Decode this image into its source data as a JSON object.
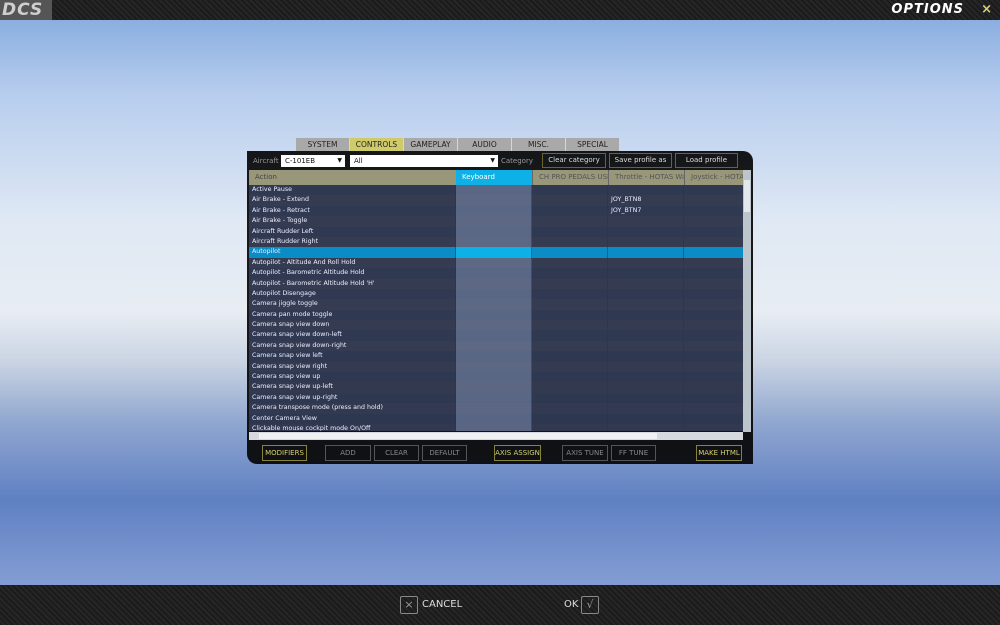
{
  "header": {
    "logo": "DCS",
    "title": "OPTIONS",
    "close": "×"
  },
  "tabs": [
    {
      "label": "SYSTEM"
    },
    {
      "label": "CONTROLS",
      "active": true
    },
    {
      "label": "GAMEPLAY"
    },
    {
      "label": "AUDIO"
    },
    {
      "label": "MISC."
    },
    {
      "label": "SPECIAL"
    }
  ],
  "toolbar": {
    "aircraft_label": "Aircraft",
    "aircraft_value": "C-101EB",
    "category_value": "All",
    "category_label": "Category",
    "clear_category": "Clear category",
    "save_profile": "Save profile as",
    "load_profile": "Load profile"
  },
  "columns": [
    "Action",
    "Keyboard",
    "CH PRO PEDALS USB",
    "Throttle - HOTAS Warthog",
    "Joystick - HOTAS Warthog"
  ],
  "rows": [
    [
      "Active Pause",
      "",
      "",
      "",
      ""
    ],
    [
      "Air Brake - Extend",
      "",
      "",
      "JOY_BTN8",
      ""
    ],
    [
      "Air Brake - Retract",
      "",
      "",
      "JOY_BTN7",
      ""
    ],
    [
      "Air Brake - Toggle",
      "",
      "",
      "",
      ""
    ],
    [
      "Aircraft Rudder Left",
      "",
      "",
      "",
      ""
    ],
    [
      "Aircraft Rudder Right",
      "",
      "",
      "",
      ""
    ],
    [
      "Autopilot",
      "",
      "",
      "",
      ""
    ],
    [
      "Autopilot - Altitude And Roll Hold",
      "",
      "",
      "",
      ""
    ],
    [
      "Autopilot - Barometric Altitude Hold",
      "",
      "",
      "",
      ""
    ],
    [
      "Autopilot - Barometric Altitude Hold 'H'",
      "",
      "",
      "",
      ""
    ],
    [
      "Autopilot Disengage",
      "",
      "",
      "",
      ""
    ],
    [
      "Camera jiggle toggle",
      "",
      "",
      "",
      ""
    ],
    [
      "Camera pan mode toggle",
      "",
      "",
      "",
      ""
    ],
    [
      "Camera snap view down",
      "",
      "",
      "",
      ""
    ],
    [
      "Camera snap view down-left",
      "",
      "",
      "",
      ""
    ],
    [
      "Camera snap view down-right",
      "",
      "",
      "",
      ""
    ],
    [
      "Camera snap view left",
      "",
      "",
      "",
      ""
    ],
    [
      "Camera snap view right",
      "",
      "",
      "",
      ""
    ],
    [
      "Camera snap view up",
      "",
      "",
      "",
      ""
    ],
    [
      "Camera snap view up-left",
      "",
      "",
      "",
      ""
    ],
    [
      "Camera snap view up-right",
      "",
      "",
      "",
      ""
    ],
    [
      "Camera transpose mode (press and hold)",
      "",
      "",
      "",
      ""
    ],
    [
      "Center Camera View",
      "",
      "",
      "",
      ""
    ],
    [
      "Clickable mouse cockpit mode On/Off",
      "",
      "",
      "",
      ""
    ]
  ],
  "selected_row": 6,
  "actions": {
    "modifiers": "MODIFIERS",
    "add": "ADD",
    "clear": "CLEAR",
    "default": "DEFAULT",
    "axis_assign": "AXIS ASSIGN",
    "axis_tune": "AXIS TUNE",
    "ff_tune": "FF TUNE",
    "make_html": "MAKE HTML"
  },
  "footer": {
    "cancel": "CANCEL",
    "ok": "OK",
    "cancel_icon": "×",
    "ok_icon": "√"
  }
}
